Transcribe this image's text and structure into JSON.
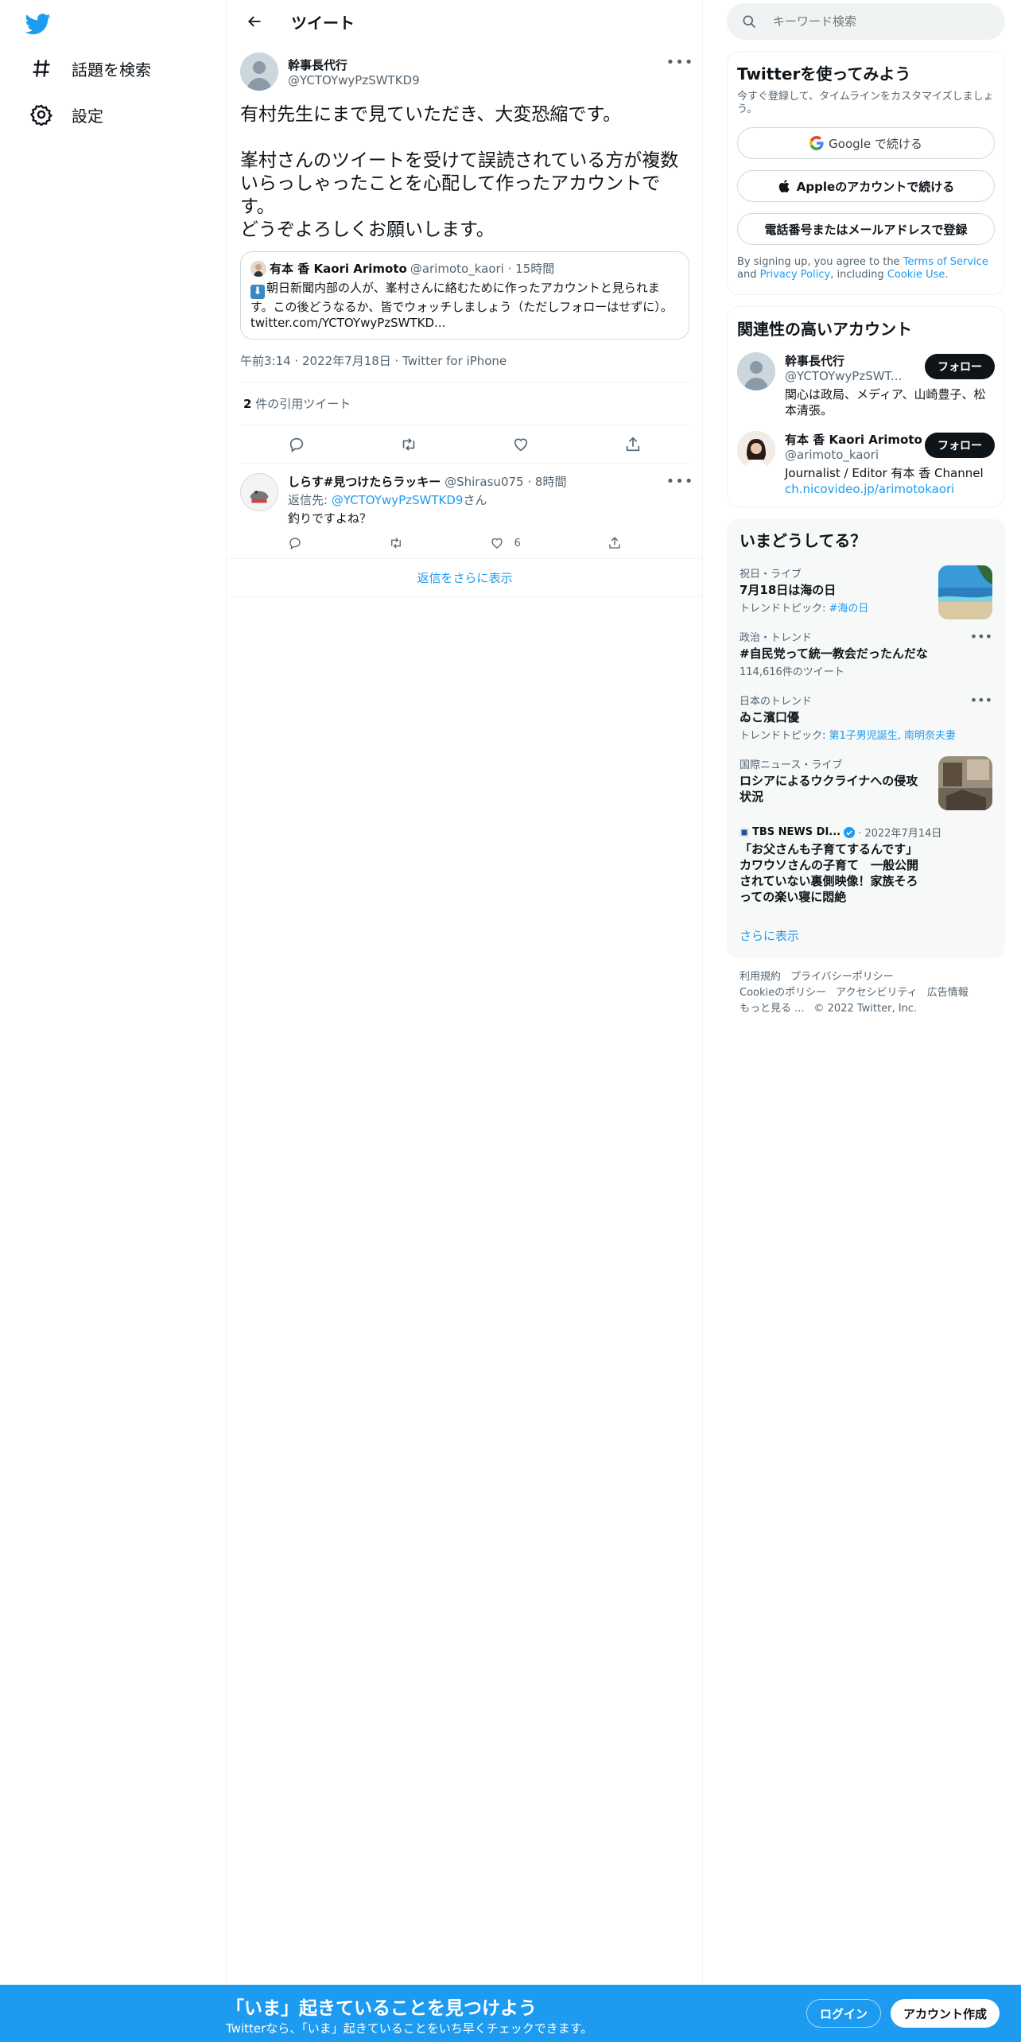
{
  "nav": {
    "logo_icon": "twitter-bird-icon",
    "items": [
      {
        "label": "話題を検索",
        "icon": "hashtag-icon"
      },
      {
        "label": "設定",
        "icon": "gear-icon"
      }
    ]
  },
  "header": {
    "title": "ツイート"
  },
  "tweet": {
    "name": "幹事長代行",
    "handle": "@YCTOYwyPzSWTKD9",
    "text": "有村先生にまで見ていただき、大変恐縮です。\n\n峯村さんのツイートを受けて誤読されている方が複数いらっしゃったことを心配して作ったアカウントです。\nどうぞよろしくお願いします。",
    "quote": {
      "name": "有本 香 Kaori Arimoto",
      "handle": "@arimoto_kaori",
      "time": "15時間",
      "body": "朝日新聞内部の人が、峯村さんに絡むために作ったアカウントと見られます。この後どうなるか、皆でウォッチしましょう（ただしフォローはせずに）。",
      "link": "twitter.com/YCTOYwyPzSWTKD..."
    },
    "meta": "午前3:14 · 2022年7月18日 · Twitter for iPhone",
    "quote_count": "2",
    "quote_count_label": " 件の引用ツイート"
  },
  "reply": {
    "name": "しらす#見つけたらラッキー",
    "handle": "@Shirasu075",
    "time": "8時間",
    "to_prefix": "返信先: ",
    "to_handle": "@YCTOYwyPzSWTKD9",
    "to_suffix": "さん",
    "text": "釣りですよね？",
    "like_count": "6"
  },
  "show_more_replies": "返信をさらに表示",
  "search": {
    "placeholder": "キーワード検索"
  },
  "signup_card": {
    "title": "Twitterを使ってみよう",
    "subtitle": "今すぐ登録して、タイムラインをカスタマイズしましょう。",
    "google": "Google で続ける",
    "apple": "Appleのアカウントで続ける",
    "phone": "電話番号またはメールアドレスで登録",
    "terms_prefix": "By signing up, you agree to the ",
    "terms_link": "Terms of Service",
    "terms_and": " and ",
    "privacy_link": "Privacy Policy",
    "terms_including": ", including ",
    "cookie_link": "Cookie Use",
    "terms_end": "."
  },
  "related": {
    "title": "関連性の高いアカウント",
    "users": [
      {
        "name": "幹事長代行",
        "handle": "@YCTOYwyPzSWT...",
        "bio": "関心は政局、メディア、山崎豊子、松本清張。",
        "follow": "フォロー"
      },
      {
        "name": "有本 香 Kaori Arimoto",
        "handle": "@arimoto_kaori",
        "bio": "Journalist / Editor 有本 香 Channel",
        "bio_link": "ch.nicovideo.jp/arimotokaori",
        "follow": "フォロー"
      }
    ]
  },
  "trends": {
    "title": "いまどうしてる？",
    "items": [
      {
        "category": "祝日・ライブ",
        "title": "7月18日は海の日",
        "sub_prefix": "トレンドトピック: ",
        "sub_link": "#海の日"
      },
      {
        "category": "政治・トレンド",
        "title": "#自民党って統一教会だったんだな",
        "sub": "114,616件のツイート"
      },
      {
        "category": "日本のトレンド",
        "title": "ゐこ濱口優",
        "sub_prefix": "トレンドトピック: ",
        "sub_link": "第1子男児誕生, 南明奈夫妻"
      },
      {
        "category": "国際ニュース・ライブ",
        "title": "ロシアによるウクライナへの侵攻状況"
      }
    ],
    "news": {
      "source": "TBS NEWS DI...",
      "date": "· 2022年7月14日",
      "title": "「お父さんも子育てするんです」カワウソさんの子育て　一般公開されていない裏側映像！家族そろっての楽い寝に悶絶"
    },
    "show_more": "さらに表示"
  },
  "footer": {
    "links": [
      "利用規約",
      "プライバシーポリシー",
      "Cookieのポリシー",
      "アクセシビリティ",
      "広告情報",
      "もっと見る ...",
      "© 2022 Twitter, Inc."
    ]
  },
  "bottombar": {
    "title": "「いま」起きていることを見つけよう",
    "subtitle": "Twitterなら、「いま」起きていることをいち早くチェックできます。",
    "login": "ログイン",
    "signup": "アカウント作成"
  },
  "colors": {
    "accent": "#1d9bf0",
    "text": "#0f1419",
    "muted": "#536471"
  }
}
